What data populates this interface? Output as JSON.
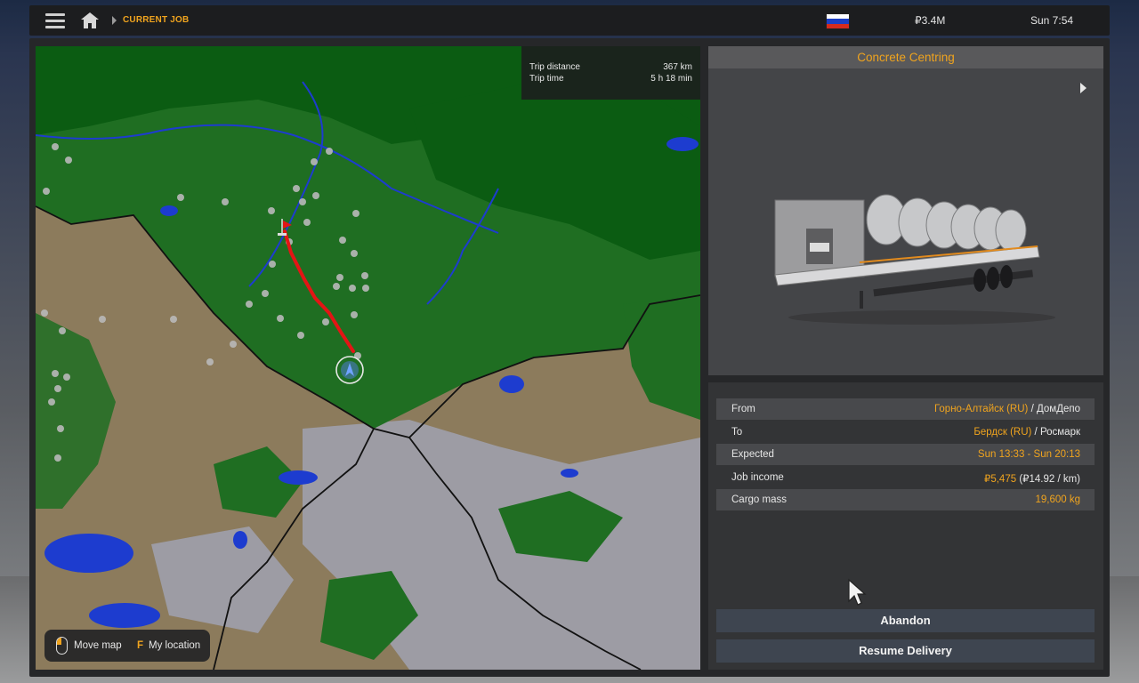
{
  "topbar": {
    "menu_icon": "hamburger-menu-icon",
    "home_icon": "home-icon",
    "breadcrumb": "CURRENT JOB",
    "flag": "russia-flag",
    "flag_colors": [
      "#ffffff",
      "#1c3fc4",
      "#d52b1e"
    ],
    "money": "₽3.4M",
    "time": "Sun 7:54"
  },
  "map": {
    "trip_distance_label": "Trip distance",
    "trip_distance_value": "367 km",
    "trip_time_label": "Trip time",
    "trip_time_value": "5 h 18 min",
    "hints": {
      "move_icon": "mouse-icon",
      "move_label": "Move map",
      "location_key": "F",
      "location_label": "My location"
    },
    "colors": {
      "forest": "#1f6e22",
      "dark_forest": "#0a5a10",
      "steppe": "#8c7b5c",
      "water": "#1d3ccf",
      "route": "#e31515",
      "snow": "#9fa0a8"
    }
  },
  "cargo": {
    "title": "Concrete Centring",
    "next_icon": "next-arrow-icon"
  },
  "job": {
    "from_label": "From",
    "from_city": "Горно-Алтайск (RU)",
    "from_sep": " / ",
    "from_company": "ДомДепо",
    "to_label": "To",
    "to_city": "Бердск (RU)",
    "to_sep": " / ",
    "to_company": "Росмарк",
    "expected_label": "Expected",
    "expected_value": "Sun 13:33 - Sun 20:13",
    "income_label": "Job income",
    "income_value": "₽5,475",
    "income_rate": " (₽14.92 / km)",
    "mass_label": "Cargo mass",
    "mass_value": "19,600 kg"
  },
  "actions": {
    "abandon": "Abandon",
    "resume": "Resume Delivery"
  }
}
